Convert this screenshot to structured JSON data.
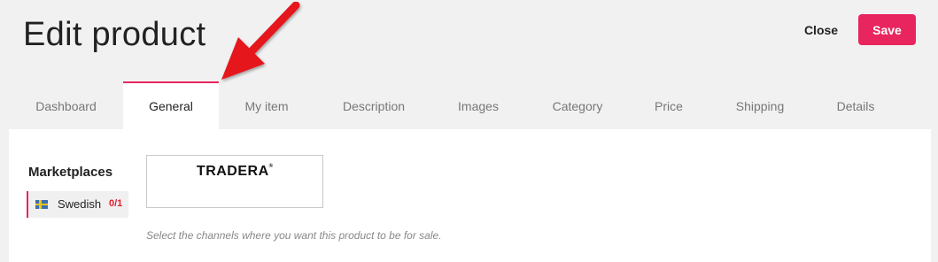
{
  "header": {
    "title": "Edit product",
    "close_label": "Close",
    "save_label": "Save",
    "accent_color": "#e8255e"
  },
  "tabs": [
    {
      "label": "Dashboard"
    },
    {
      "label": "General"
    },
    {
      "label": "My item"
    },
    {
      "label": "Description"
    },
    {
      "label": "Images"
    },
    {
      "label": "Category"
    },
    {
      "label": "Price"
    },
    {
      "label": "Shipping"
    },
    {
      "label": "Details"
    }
  ],
  "active_tab": "General",
  "marketplaces": {
    "heading": "Marketplaces",
    "items": [
      {
        "label": "Swedish",
        "count": "0/1",
        "icon": "sweden-flag-icon"
      }
    ]
  },
  "channels": [
    {
      "name": "TRADERA",
      "mark": "®",
      "selected": false
    }
  ],
  "hint": "Select the channels where you want this product to be for sale.",
  "annotation": {
    "icon": "red-arrow-icon",
    "color": "#e5161b"
  }
}
